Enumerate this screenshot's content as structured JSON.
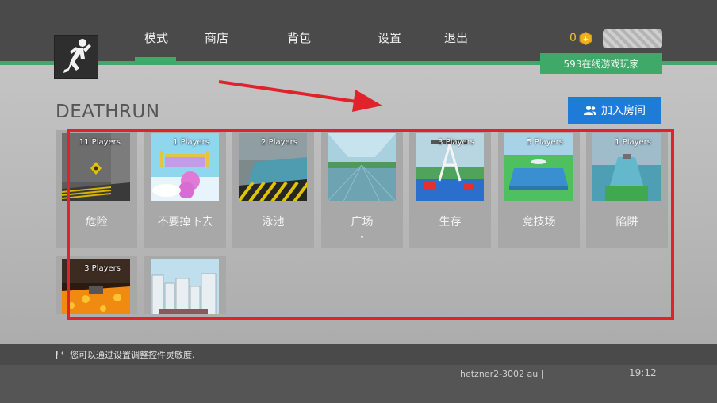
{
  "nav": {
    "items": [
      "模式",
      "商店",
      "背包",
      "设置",
      "退出"
    ],
    "active": "模式"
  },
  "wallet": {
    "coins": "0",
    "coin_icon": "coin-icon"
  },
  "online_label": "593在线游戏玩家",
  "page_title": "DEATHRUN",
  "join_button": {
    "label": "加入房间",
    "icon": "user-group-icon"
  },
  "maps": [
    {
      "players": "11 Players",
      "label": "危险"
    },
    {
      "players": "1 Players",
      "label": "不要掉下去"
    },
    {
      "players": "2 Players",
      "label": "泳池"
    },
    {
      "players": "",
      "label": "广场"
    },
    {
      "players": "3 Players",
      "label": "生存"
    },
    {
      "players": "5 Players",
      "label": "竞技场"
    },
    {
      "players": "1 Players",
      "label": "陷阱"
    },
    {
      "players": "3 Players",
      "label": ""
    },
    {
      "players": "",
      "label": ""
    }
  ],
  "tip": {
    "icon": "flag-icon",
    "text": "您可以通过设置调整控件灵敏度."
  },
  "footer": {
    "server": "hetzner2-3002 au  |",
    "clock": "19:12"
  },
  "colors": {
    "accent_green": "#3fa96a",
    "button_blue": "#1f7bd8",
    "annotation_red": "#e0232a"
  }
}
